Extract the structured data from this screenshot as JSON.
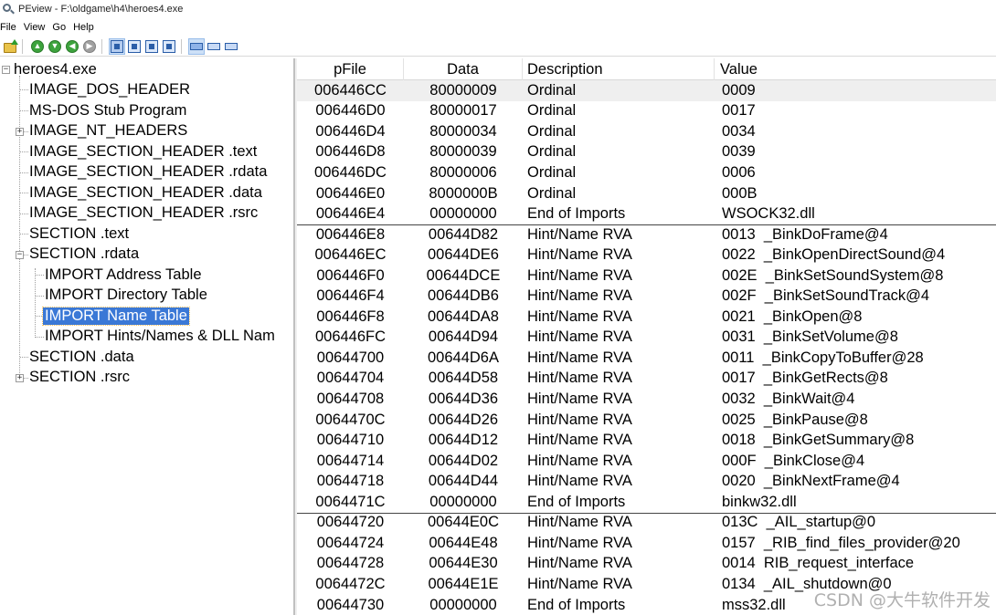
{
  "window": {
    "title": "PEview - F:\\oldgame\\h4\\heroes4.exe"
  },
  "menu": [
    "File",
    "View",
    "Go",
    "Help"
  ],
  "toolbar": {
    "buttons": [
      "open-icon",
      "back-icon",
      "forward-icon",
      "previous-icon",
      "next-icon",
      "view-icon-1",
      "view-icon-2",
      "view-icon-3",
      "view-icon-4",
      "format-icon-1",
      "format-icon-2",
      "format-icon-3"
    ]
  },
  "tree": {
    "root": "heroes4.exe",
    "items": [
      "IMAGE_DOS_HEADER",
      "MS-DOS Stub Program",
      "IMAGE_NT_HEADERS",
      "IMAGE_SECTION_HEADER .text",
      "IMAGE_SECTION_HEADER .rdata",
      "IMAGE_SECTION_HEADER .data",
      "IMAGE_SECTION_HEADER .rsrc",
      "SECTION .text",
      "SECTION .rdata",
      "IMPORT Address Table",
      "IMPORT Directory Table",
      "IMPORT Name Table",
      "IMPORT Hints/Names & DLL Nam",
      "SECTION .data",
      "SECTION .rsrc"
    ],
    "selected": "IMPORT Name Table"
  },
  "table": {
    "columns": [
      "pFile",
      "Data",
      "Description",
      "Value"
    ],
    "rows": [
      [
        "006446CC",
        "80000009",
        "Ordinal",
        "0009"
      ],
      [
        "006446D0",
        "80000017",
        "Ordinal",
        "0017"
      ],
      [
        "006446D4",
        "80000034",
        "Ordinal",
        "0034"
      ],
      [
        "006446D8",
        "80000039",
        "Ordinal",
        "0039"
      ],
      [
        "006446DC",
        "80000006",
        "Ordinal",
        "0006"
      ],
      [
        "006446E0",
        "8000000B",
        "Ordinal",
        "000B"
      ],
      [
        "006446E4",
        "00000000",
        "End of Imports",
        "WSOCK32.dll"
      ],
      [
        "006446E8",
        "00644D82",
        "Hint/Name RVA",
        "0013  _BinkDoFrame@4"
      ],
      [
        "006446EC",
        "00644DE6",
        "Hint/Name RVA",
        "0022  _BinkOpenDirectSound@4"
      ],
      [
        "006446F0",
        "00644DCE",
        "Hint/Name RVA",
        "002E  _BinkSetSoundSystem@8"
      ],
      [
        "006446F4",
        "00644DB6",
        "Hint/Name RVA",
        "002F  _BinkSetSoundTrack@4"
      ],
      [
        "006446F8",
        "00644DA8",
        "Hint/Name RVA",
        "0021  _BinkOpen@8"
      ],
      [
        "006446FC",
        "00644D94",
        "Hint/Name RVA",
        "0031  _BinkSetVolume@8"
      ],
      [
        "00644700",
        "00644D6A",
        "Hint/Name RVA",
        "0011  _BinkCopyToBuffer@28"
      ],
      [
        "00644704",
        "00644D58",
        "Hint/Name RVA",
        "0017  _BinkGetRects@8"
      ],
      [
        "00644708",
        "00644D36",
        "Hint/Name RVA",
        "0032  _BinkWait@4"
      ],
      [
        "0064470C",
        "00644D26",
        "Hint/Name RVA",
        "0025  _BinkPause@8"
      ],
      [
        "00644710",
        "00644D12",
        "Hint/Name RVA",
        "0018  _BinkGetSummary@8"
      ],
      [
        "00644714",
        "00644D02",
        "Hint/Name RVA",
        "000F  _BinkClose@4"
      ],
      [
        "00644718",
        "00644D44",
        "Hint/Name RVA",
        "0020  _BinkNextFrame@4"
      ],
      [
        "0064471C",
        "00000000",
        "End of Imports",
        "binkw32.dll"
      ],
      [
        "00644720",
        "00644E0C",
        "Hint/Name RVA",
        "013C  _AIL_startup@0"
      ],
      [
        "00644724",
        "00644E48",
        "Hint/Name RVA",
        "0157  _RIB_find_files_provider@20"
      ],
      [
        "00644728",
        "00644E30",
        "Hint/Name RVA",
        "0014  RIB_request_interface"
      ],
      [
        "0064472C",
        "00644E1E",
        "Hint/Name RVA",
        "0134  _AIL_shutdown@0"
      ],
      [
        "00644730",
        "00000000",
        "End of Imports",
        "mss32.dll"
      ]
    ],
    "highlighted_row": 0
  },
  "watermark": "CSDN @大牛软件开发"
}
